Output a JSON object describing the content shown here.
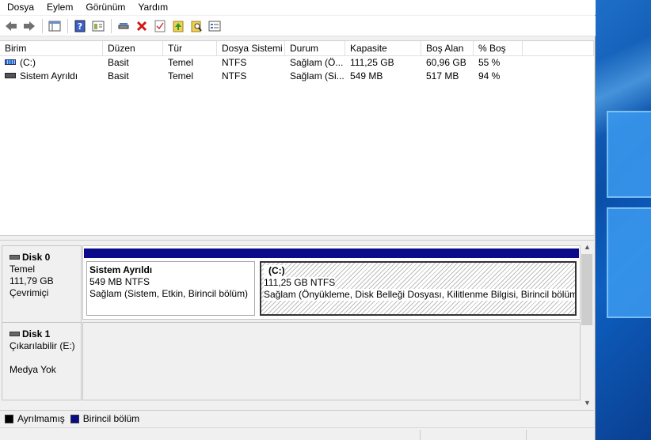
{
  "menu": [
    "Dosya",
    "Eylem",
    "Görünüm",
    "Yardım"
  ],
  "toolbar": {
    "icons": [
      "back-arrow-icon",
      "forward-arrow-icon",
      "console-icon",
      "help-icon",
      "properties-icon",
      "connect-icon",
      "delete-icon",
      "check-icon",
      "up-folder-icon",
      "search-folder-icon",
      "list-icon"
    ]
  },
  "volume_list": {
    "columns": [
      "Birim",
      "Düzen",
      "Tür",
      "Dosya Sistemi",
      "Durum",
      "Kapasite",
      "Boş Alan",
      "% Boş"
    ],
    "rows": [
      {
        "birim": "(C:)",
        "duzen": "Basit",
        "tur": "Temel",
        "fs": "NTFS",
        "durum": "Sağlam (Ö...",
        "kapasite": "111,25 GB",
        "bos": "60,96 GB",
        "yuzde": "55 %"
      },
      {
        "birim": "Sistem Ayrıldı",
        "duzen": "Basit",
        "tur": "Temel",
        "fs": "NTFS",
        "durum": "Sağlam (Si...",
        "kapasite": "549 MB",
        "bos": "517 MB",
        "yuzde": "94 %"
      }
    ]
  },
  "disks": {
    "disk0": {
      "name": "Disk 0",
      "type": "Temel",
      "size": "111,79 GB",
      "status": "Çevrimiçi",
      "partitions": [
        {
          "name": "Sistem Ayrıldı",
          "size": "549 MB NTFS",
          "status": "Sağlam (Sistem, Etkin, Birincil bölüm)"
        },
        {
          "name": "(C:)",
          "size": "111,25 GB NTFS",
          "status": "Sağlam (Önyükleme, Disk Belleği Dosyası, Kilitlenme Bilgisi, Birincil bölüm)"
        }
      ]
    },
    "disk1": {
      "name": "Disk 1",
      "type": "Çıkarılabilir (E:)",
      "status": "Medya Yok"
    }
  },
  "legend": [
    {
      "label": "Ayrılmamış",
      "color": "#000000"
    },
    {
      "label": "Birincil bölüm",
      "color": "#0a0a8a"
    }
  ]
}
